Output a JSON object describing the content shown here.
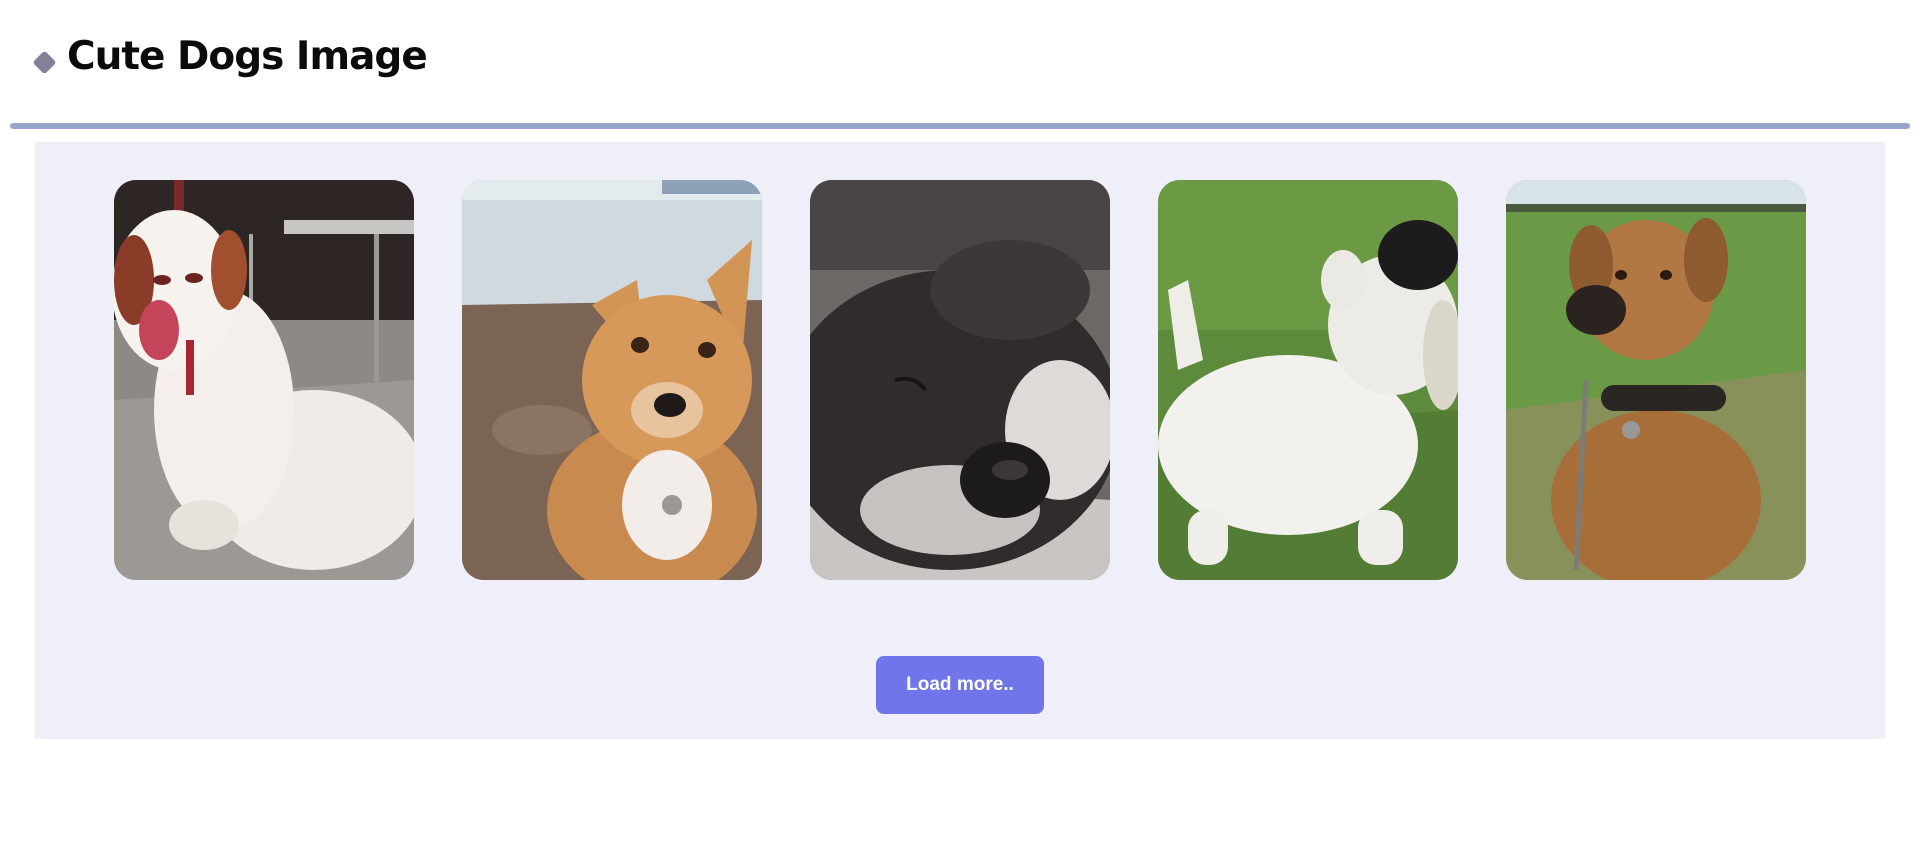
{
  "header": {
    "title": "Cute Dogs Image"
  },
  "gallery": {
    "images": [
      {
        "subject": "white spaniel sitting indoors"
      },
      {
        "subject": "fox-like dog on pebble beach"
      },
      {
        "subject": "black and white puppy sleeping"
      },
      {
        "subject": "white terrier on grass"
      },
      {
        "subject": "brown ridgeback with studded collar in field"
      }
    ],
    "load_more_label": "Load more.."
  },
  "colors": {
    "accent": "#7076e9",
    "rule": "#98a4cb",
    "gallery_bg": "#efeffa",
    "logo": "#857f97"
  }
}
